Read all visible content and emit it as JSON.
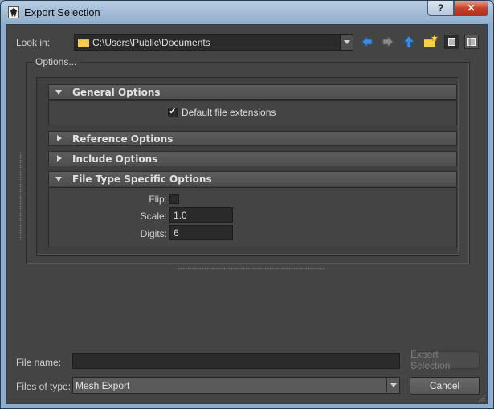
{
  "window": {
    "title": "Export Selection",
    "help_label": "?",
    "close_label": "✕"
  },
  "look_in": {
    "label": "Look in:",
    "path": "C:\\Users\\Public\\Documents"
  },
  "options": {
    "group_title": "Options...",
    "general": {
      "title": "General Options",
      "expanded": true,
      "default_ext_label": "Default file extensions",
      "default_ext_checked": true
    },
    "reference": {
      "title": "Reference Options",
      "expanded": false
    },
    "include": {
      "title": "Include Options",
      "expanded": false
    },
    "file_type": {
      "title": "File Type Specific Options",
      "expanded": true,
      "flip_label": "Flip:",
      "flip_checked": false,
      "scale_label": "Scale:",
      "scale_value": "1.0",
      "digits_label": "Digits:",
      "digits_value": "6"
    }
  },
  "bottom": {
    "file_name_label": "File name:",
    "file_name_value": "",
    "export_label": "Export Selection",
    "files_of_type_label": "Files of type:",
    "files_of_type_value": "Mesh Export",
    "cancel_label": "Cancel"
  },
  "icons": [
    "app-icon",
    "folder-icon",
    "back-arrow-icon",
    "forward-arrow-icon",
    "up-arrow-icon",
    "new-folder-icon",
    "list-view-icon",
    "detail-view-icon"
  ],
  "colors": {
    "background": "#444444",
    "field": "#2b2b2b",
    "header": "#555555",
    "nav_arrow": "#3a8ee6"
  }
}
